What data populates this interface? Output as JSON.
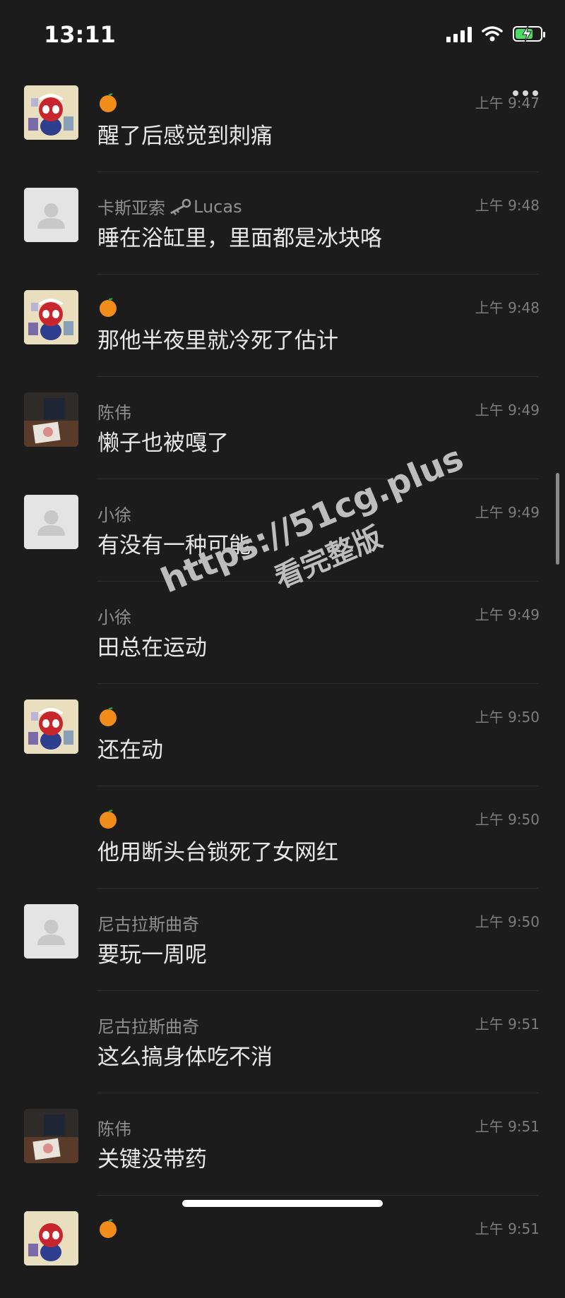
{
  "status_bar": {
    "time": "13:11",
    "battery_color": "#4cd964"
  },
  "messages": [
    {
      "sender": "",
      "sender_icon": "orange-icon",
      "time": "上午 9:47",
      "text": "醒了后感觉到刺痛",
      "avatar": "spider"
    },
    {
      "sender": "卡斯亚索",
      "sender_suffix": "Lucas",
      "sender_icon": "key-icon",
      "time": "上午 9:48",
      "text": "睡在浴缸里，里面都是冰块咯",
      "avatar": "default"
    },
    {
      "sender": "",
      "sender_icon": "orange-icon",
      "time": "上午 9:48",
      "text": "那他半夜里就冷死了估计",
      "avatar": "spider"
    },
    {
      "sender": "陈伟",
      "time": "上午 9:49",
      "text": "懒子也被嘎了",
      "avatar": "photo"
    },
    {
      "sender": "小徐",
      "time": "上午 9:49",
      "text": "有没有一种可能",
      "avatar": "default"
    },
    {
      "sender": "小徐",
      "time": "上午 9:49",
      "text": "田总在运动",
      "avatar": "none"
    },
    {
      "sender": "",
      "sender_icon": "orange-icon",
      "time": "上午 9:50",
      "text": "还在动",
      "avatar": "spider"
    },
    {
      "sender": "",
      "sender_icon": "orange-icon",
      "time": "上午 9:50",
      "text": "他用断头台锁死了女网红",
      "avatar": "none"
    },
    {
      "sender": "尼古拉斯曲奇",
      "time": "上午 9:50",
      "text": "要玩一周呢",
      "avatar": "default"
    },
    {
      "sender": "尼古拉斯曲奇",
      "time": "上午 9:51",
      "text": "这么搞身体吃不消",
      "avatar": "none"
    },
    {
      "sender": "陈伟",
      "time": "上午 9:51",
      "text": "关键没带药",
      "avatar": "photo"
    },
    {
      "sender": "",
      "sender_icon": "orange-icon",
      "time": "上午 9:51",
      "text": "",
      "avatar": "spider"
    }
  ],
  "watermark": {
    "url": "https://51cg.plus",
    "text": "看完整版"
  }
}
